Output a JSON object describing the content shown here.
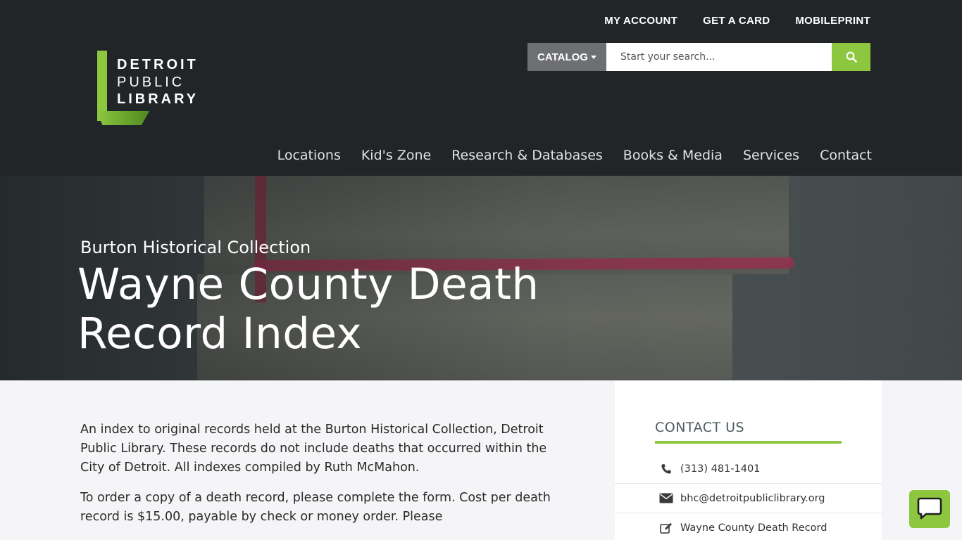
{
  "utility_nav": [
    {
      "label": "MY ACCOUNT"
    },
    {
      "label": "GET A CARD"
    },
    {
      "label": "MOBILEPRINT"
    }
  ],
  "logo": {
    "line1": "DETROIT",
    "line2": "PUBLIC",
    "line3": "LIBRARY"
  },
  "search": {
    "category_label": "CATALOG",
    "placeholder": "Start your search..."
  },
  "main_nav": [
    {
      "label": "Locations"
    },
    {
      "label": "Kid's Zone"
    },
    {
      "label": "Research & Databases"
    },
    {
      "label": "Books & Media"
    },
    {
      "label": "Services"
    },
    {
      "label": "Contact"
    }
  ],
  "hero": {
    "kicker": "Burton Historical Collection",
    "title": "Wayne County Death Record Index"
  },
  "content": {
    "paragraphs": [
      "An index to original records held at the Burton Historical Collection, Detroit Public Library.  These records do not include deaths that occurred within the City of Detroit.  All indexes compiled by Ruth McMahon.",
      "To order a copy of a death record, please complete the form.  Cost per death record is $15.00, payable by check or money order.  Please"
    ]
  },
  "sidebar": {
    "title": "CONTACT US",
    "phone": "(313) 481-1401",
    "email": "bhc@detroitpubliclibrary.org",
    "form_link": "Wayne County Death Record"
  },
  "colors": {
    "accent": "#8dc63f",
    "header_bg": "#222528",
    "catalog_bg": "#6d6f72"
  },
  "icons": {
    "search": "search-icon",
    "phone": "phone-icon",
    "email": "envelope-icon",
    "form": "edit-icon",
    "chat": "chat-icon"
  }
}
